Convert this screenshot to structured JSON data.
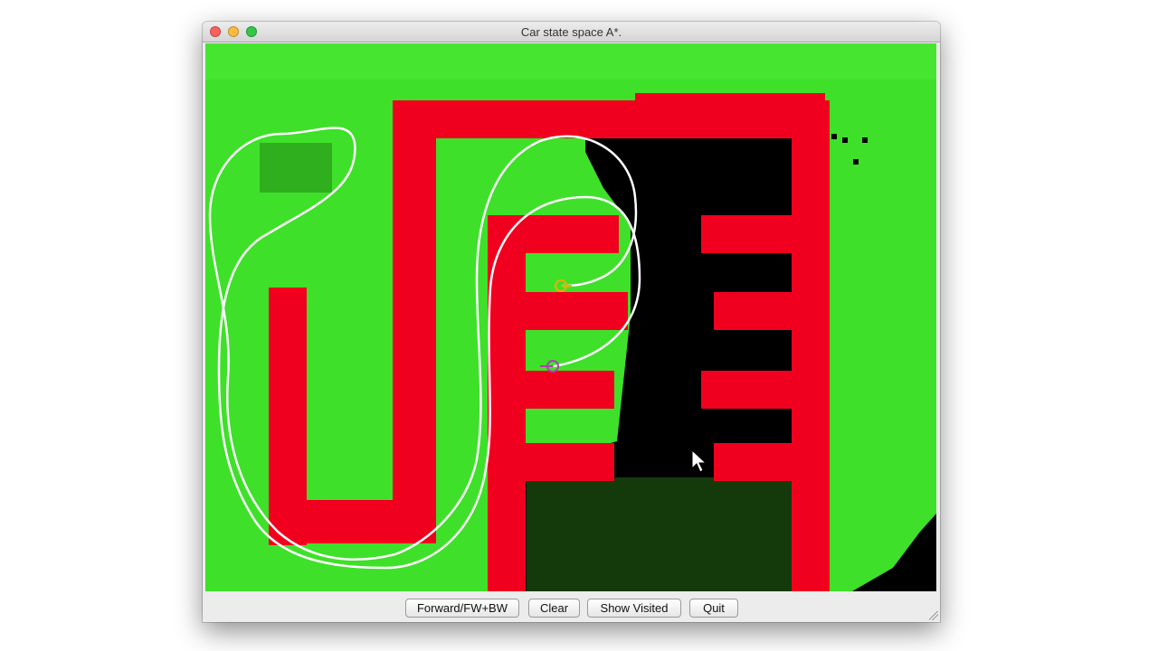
{
  "window": {
    "title": "Car state space A*."
  },
  "buttons": {
    "forward": "Forward/FW+BW",
    "clear": "Clear",
    "show_visited": "Show Visited",
    "quit": "Quit"
  },
  "colors": {
    "free_space": "#3fe02a",
    "wall": "#f0001e",
    "unexplored": "#000000",
    "path": "#ffffff",
    "start_marker": "#e8b000",
    "goal_marker": "#b040b0"
  },
  "icons": {
    "cursor": "mouse-pointer-icon"
  }
}
